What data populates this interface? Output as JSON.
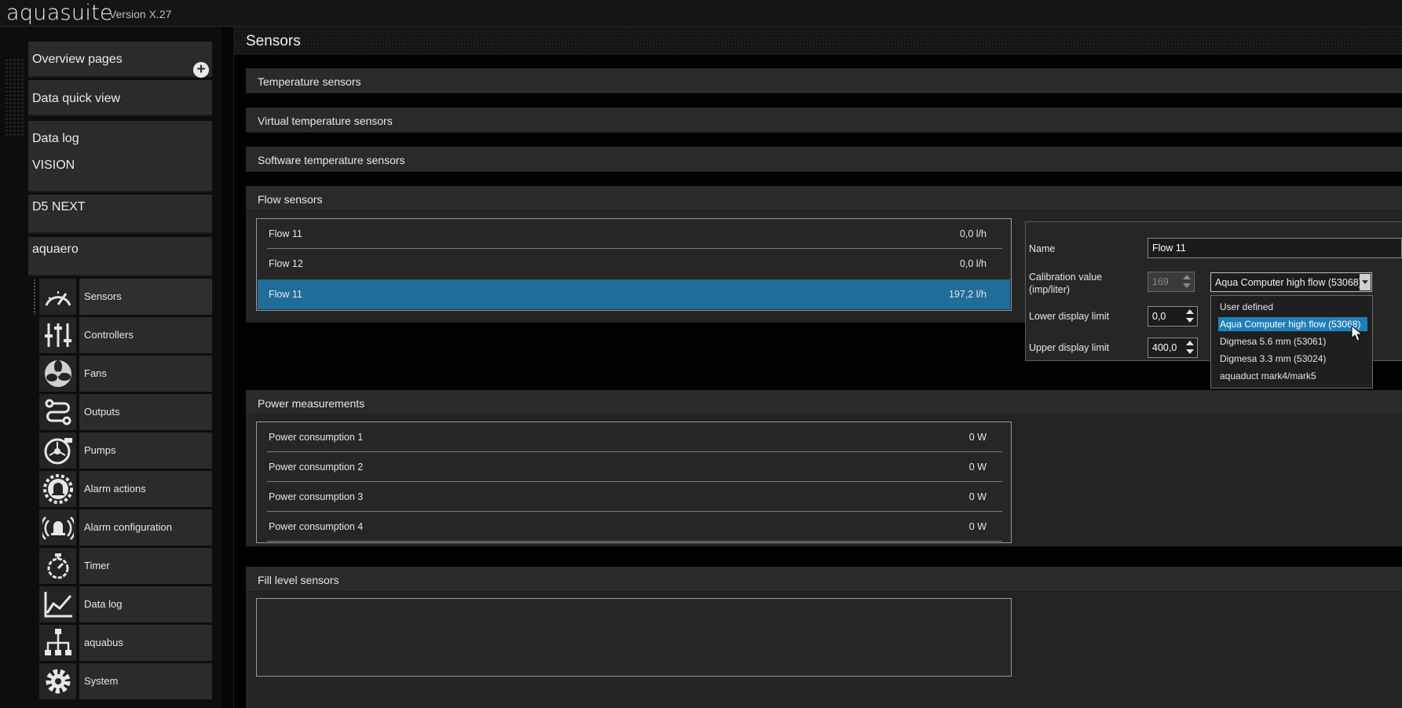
{
  "app": {
    "name": "aquasuite",
    "version": "Version X.27"
  },
  "sidebar": {
    "top_items": [
      {
        "label": "Overview pages"
      },
      {
        "label": "Data quick view"
      },
      {
        "label": "Data log"
      },
      {
        "label": "VISION"
      },
      {
        "label": "D5 NEXT"
      },
      {
        "label": "aquaero"
      }
    ],
    "add_symbol": "+",
    "sub_items": [
      {
        "label": "Sensors",
        "icon": "speedometer-icon"
      },
      {
        "label": "Controllers",
        "icon": "sliders-icon"
      },
      {
        "label": "Fans",
        "icon": "fan-icon"
      },
      {
        "label": "Outputs",
        "icon": "outputs-icon"
      },
      {
        "label": "Pumps",
        "icon": "pump-icon"
      },
      {
        "label": "Alarm actions",
        "icon": "alarm-bell-gear-icon"
      },
      {
        "label": "Alarm configuration",
        "icon": "alarm-bell-waves-icon"
      },
      {
        "label": "Timer",
        "icon": "stopwatch-icon"
      },
      {
        "label": "Data log",
        "icon": "line-chart-icon"
      },
      {
        "label": "aquabus",
        "icon": "hierarchy-icon"
      },
      {
        "label": "System",
        "icon": "gear-icon"
      }
    ]
  },
  "main": {
    "title": "Sensors",
    "sections": {
      "temperature": "Temperature sensors",
      "virtual_temperature": "Virtual temperature sensors",
      "software_temperature": "Software temperature sensors",
      "flow": "Flow sensors",
      "power": "Power measurements",
      "fill_level": "Fill level sensors"
    },
    "flow_sensors": [
      {
        "name": "Flow 11",
        "value": "0,0 l/h"
      },
      {
        "name": "Flow 12",
        "value": "0,0 l/h"
      },
      {
        "name": "Flow 11",
        "value": "197,2 l/h"
      }
    ],
    "power_measurements": [
      {
        "name": "Power consumption 1",
        "value": "0 W"
      },
      {
        "name": "Power consumption 2",
        "value": "0 W"
      },
      {
        "name": "Power consumption 3",
        "value": "0 W"
      },
      {
        "name": "Power consumption 4",
        "value": "0 W"
      }
    ],
    "detail": {
      "name_label": "Name",
      "name_value": "Flow 11",
      "calibration_label_1": "Calibration value",
      "calibration_label_2": "(imp/liter)",
      "calibration_value": "169",
      "sensor_type_selected": "Aqua Computer high flow (53068)",
      "sensor_type_options": [
        "User defined",
        "Aqua Computer high flow (53068)",
        "Digmesa 5.6 mm (53061)",
        "Digmesa 3.3 mm (53024)",
        "aquaduct mark4/mark5"
      ],
      "lower_label": "Lower display limit",
      "lower_value": "0,0",
      "upper_label": "Upper display limit",
      "upper_value": "400,0"
    }
  },
  "colors": {
    "selection": "#1f6e99",
    "dropdown_highlight": "#1f7fb8"
  }
}
